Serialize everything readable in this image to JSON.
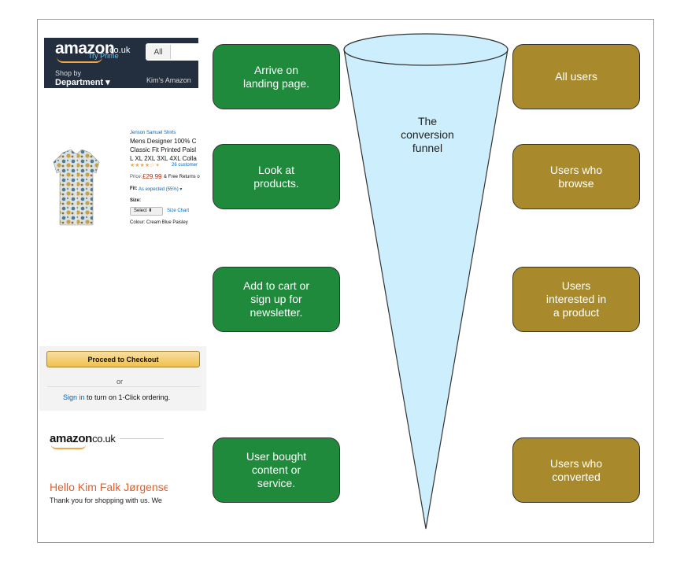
{
  "amazon_header": {
    "logo": "amazon",
    "logo_suffix": ".co.uk",
    "prime": "Try Prime",
    "search_category": "All",
    "shop_by": "Shop by",
    "department": "Department ▾",
    "account": "Kim's Amazon"
  },
  "product": {
    "brand": "Jenson Samuel Shirts",
    "title": "Mens Designer 100% C\nClassic Fit Printed Paisl\nL XL 2XL 3XL 4XL Colla",
    "stars": "★★★★☆ ▾",
    "reviews": "26 customer",
    "price_label": "Price:",
    "price": "£29.99",
    "free_returns": "& Free Returns o",
    "fit_label": "Fit:",
    "fit": "As expected (55%) ▾",
    "size_label": "Size:",
    "size_select": "Select  ⬍",
    "size_chart": "Size Chart",
    "colour": "Colour: Cream Blue Paisley"
  },
  "checkout": {
    "button": "Proceed to Checkout",
    "or": "or",
    "signin_link": "Sign in",
    "signin_rest": " to turn on 1-Click ordering."
  },
  "email": {
    "logo": "amazon",
    "logo_suffix": "co.uk",
    "greeting": "Hello Kim Falk Jørgensen",
    "thanks": "Thank you for shopping with us. We"
  },
  "funnel_label": "The\nconversion\nfunnel",
  "stages": [
    {
      "action": "Arrive on\nlanding page.",
      "audience": "All users"
    },
    {
      "action": "Look at\nproducts.",
      "audience": "Users who\nbrowse"
    },
    {
      "action": "Add to cart or\nsign up for\nnewsletter.",
      "audience": "Users\ninterested in\na product"
    },
    {
      "action": "User bought\ncontent or\nservice.",
      "audience": "Users who\nconverted"
    }
  ],
  "colors": {
    "action_box": "#1f8a3c",
    "audience_box": "#a88a2c",
    "funnel_fill": "#cdeefc",
    "funnel_stroke": "#333333"
  }
}
